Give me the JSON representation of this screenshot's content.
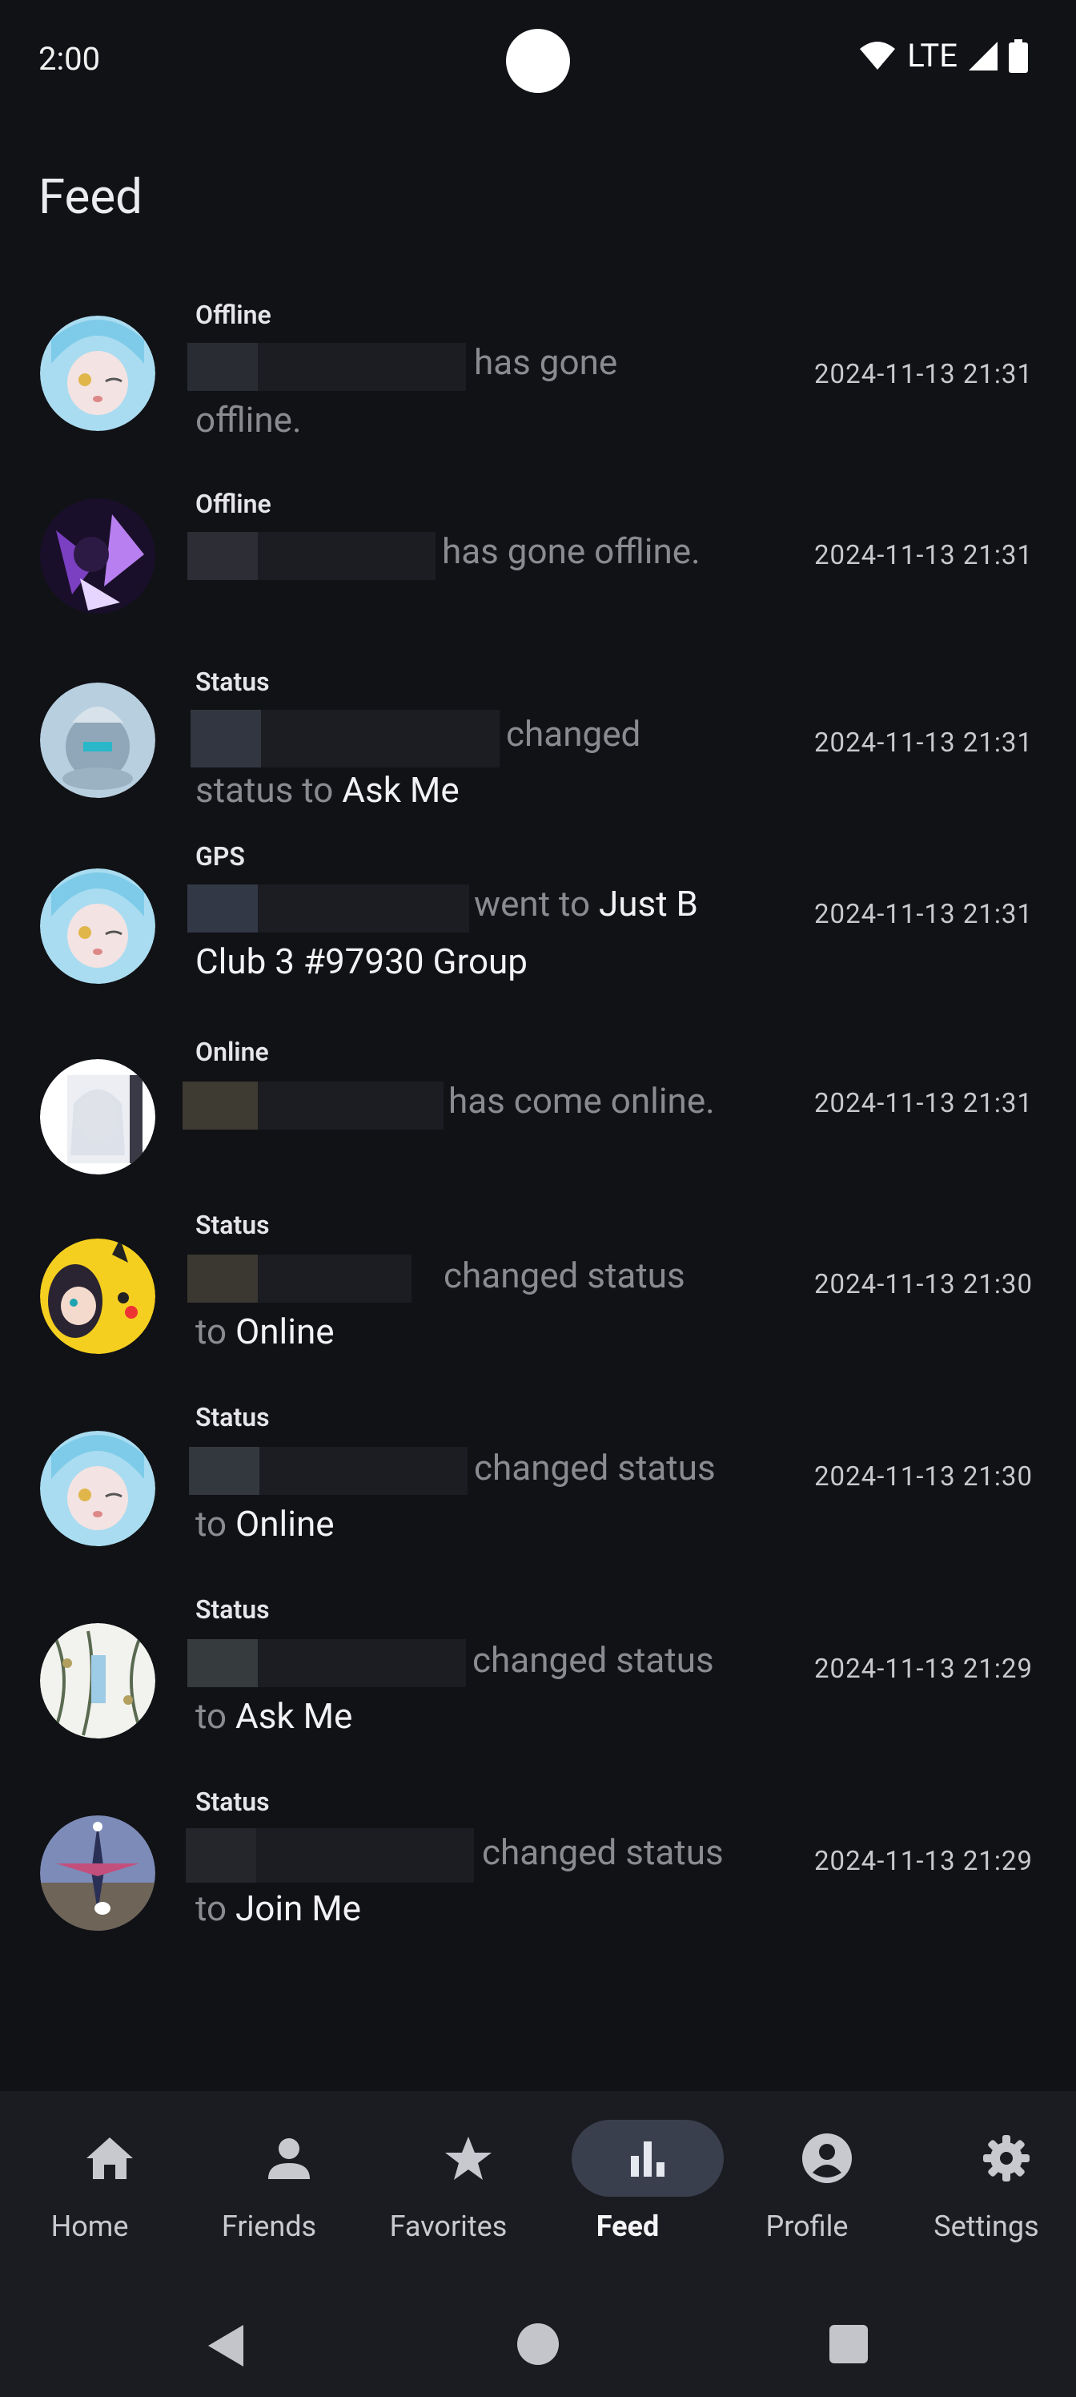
{
  "status_bar": {
    "time": "2:00",
    "network": "LTE"
  },
  "page": {
    "title": "Feed"
  },
  "feed": [
    {
      "type": "Offline",
      "line1": "has gone",
      "line2": "offline.",
      "line2_highlight": "",
      "time": "2024-11-13 21:31"
    },
    {
      "type": "Offline",
      "line1": "has gone offline.",
      "line2": "",
      "line2_highlight": "",
      "time": "2024-11-13 21:31"
    },
    {
      "type": "Status",
      "line1": "changed",
      "line2": "status to ",
      "line2_highlight": "Ask Me",
      "time": "2024-11-13 21:31"
    },
    {
      "type": "GPS",
      "line1": "went to ",
      "line1_highlight": "Just B",
      "line2": "",
      "line2_highlight": "Club 3 #97930 Group",
      "time": "2024-11-13 21:31"
    },
    {
      "type": "Online",
      "line1": "has come online.",
      "line2": "",
      "line2_highlight": "",
      "time": "2024-11-13 21:31"
    },
    {
      "type": "Status",
      "line1": "changed status",
      "line2": "to ",
      "line2_highlight": "Online",
      "time": "2024-11-13 21:30"
    },
    {
      "type": "Status",
      "line1": "changed status",
      "line2": "to ",
      "line2_highlight": "Online",
      "time": "2024-11-13 21:30"
    },
    {
      "type": "Status",
      "line1": "changed status",
      "line2": "to ",
      "line2_highlight": "Ask Me",
      "time": "2024-11-13 21:29"
    },
    {
      "type": "Status",
      "line1": "changed status",
      "line2": "to ",
      "line2_highlight": "Join Me",
      "time": "2024-11-13 21:29"
    }
  ],
  "nav": {
    "items": [
      {
        "label": "Home",
        "icon": "home-icon"
      },
      {
        "label": "Friends",
        "icon": "person-icon"
      },
      {
        "label": "Favorites",
        "icon": "star-icon"
      },
      {
        "label": "Feed",
        "icon": "bar-chart-icon",
        "active": true
      },
      {
        "label": "Profile",
        "icon": "account-circle-icon"
      },
      {
        "label": "Settings",
        "icon": "gear-icon"
      }
    ]
  },
  "colors": {
    "background": "#111216",
    "nav_background": "#1b1c21",
    "active_pill": "#3a3f4e",
    "muted_text": "#8a8b90"
  }
}
